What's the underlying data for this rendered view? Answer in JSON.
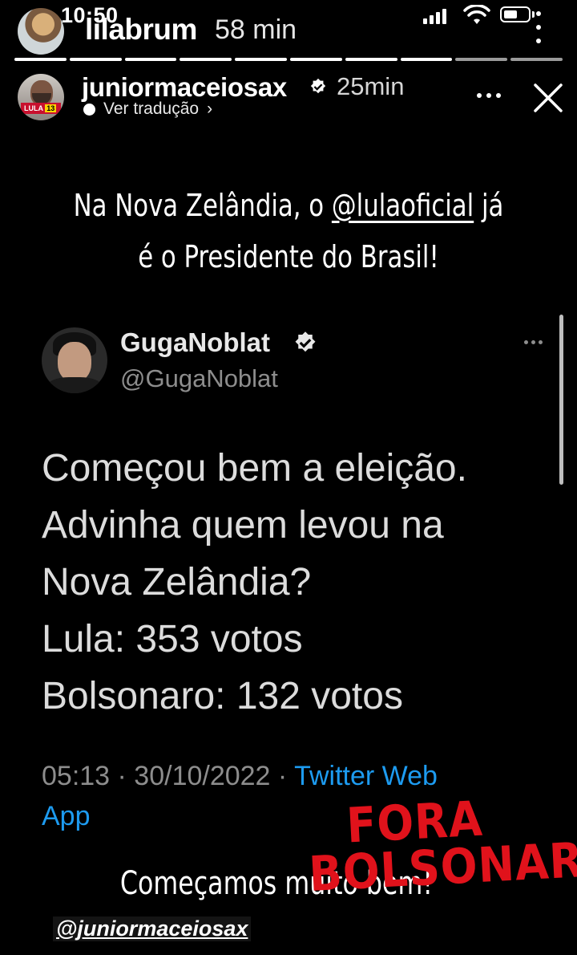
{
  "status_bar": {
    "time": "10:50"
  },
  "outer_story": {
    "username": "lilabrum",
    "time_ago": "58 min",
    "segments": 10,
    "completed_segments": 8
  },
  "inner_story": {
    "username": "juniormaceiosax",
    "time_ago": "25min",
    "translate_label": "Ver tradução",
    "avatar_badge_text": "LULA",
    "avatar_badge_number": "13"
  },
  "headline": {
    "line1_before": "Na Nova Zelândia, o ",
    "mention": "@lulaoficial",
    "line1_after": " já",
    "line2": "é o Presidente do Brasil!"
  },
  "tweet": {
    "name": "GugaNoblat",
    "handle": "@GugaNoblat",
    "body_lines": [
      "Começou bem a eleição.",
      "Advinha quem levou na",
      "Nova Zelândia?",
      "Lula: 353 votos",
      "Bolsonaro: 132 votos"
    ],
    "timestamp": "05:13 · 30/10/2022 · ",
    "source_part1": "Twitter Web",
    "source_part2": "App"
  },
  "stickers": {
    "fora_line1": "FORA",
    "fora_line2": "BOLSONARO",
    "caption": "Começamos muito bem!",
    "mention_tag": "@juniormaceiosax"
  },
  "colors": {
    "link": "#1d9bf0",
    "sticker_red": "#e0121b",
    "background": "#000000"
  }
}
